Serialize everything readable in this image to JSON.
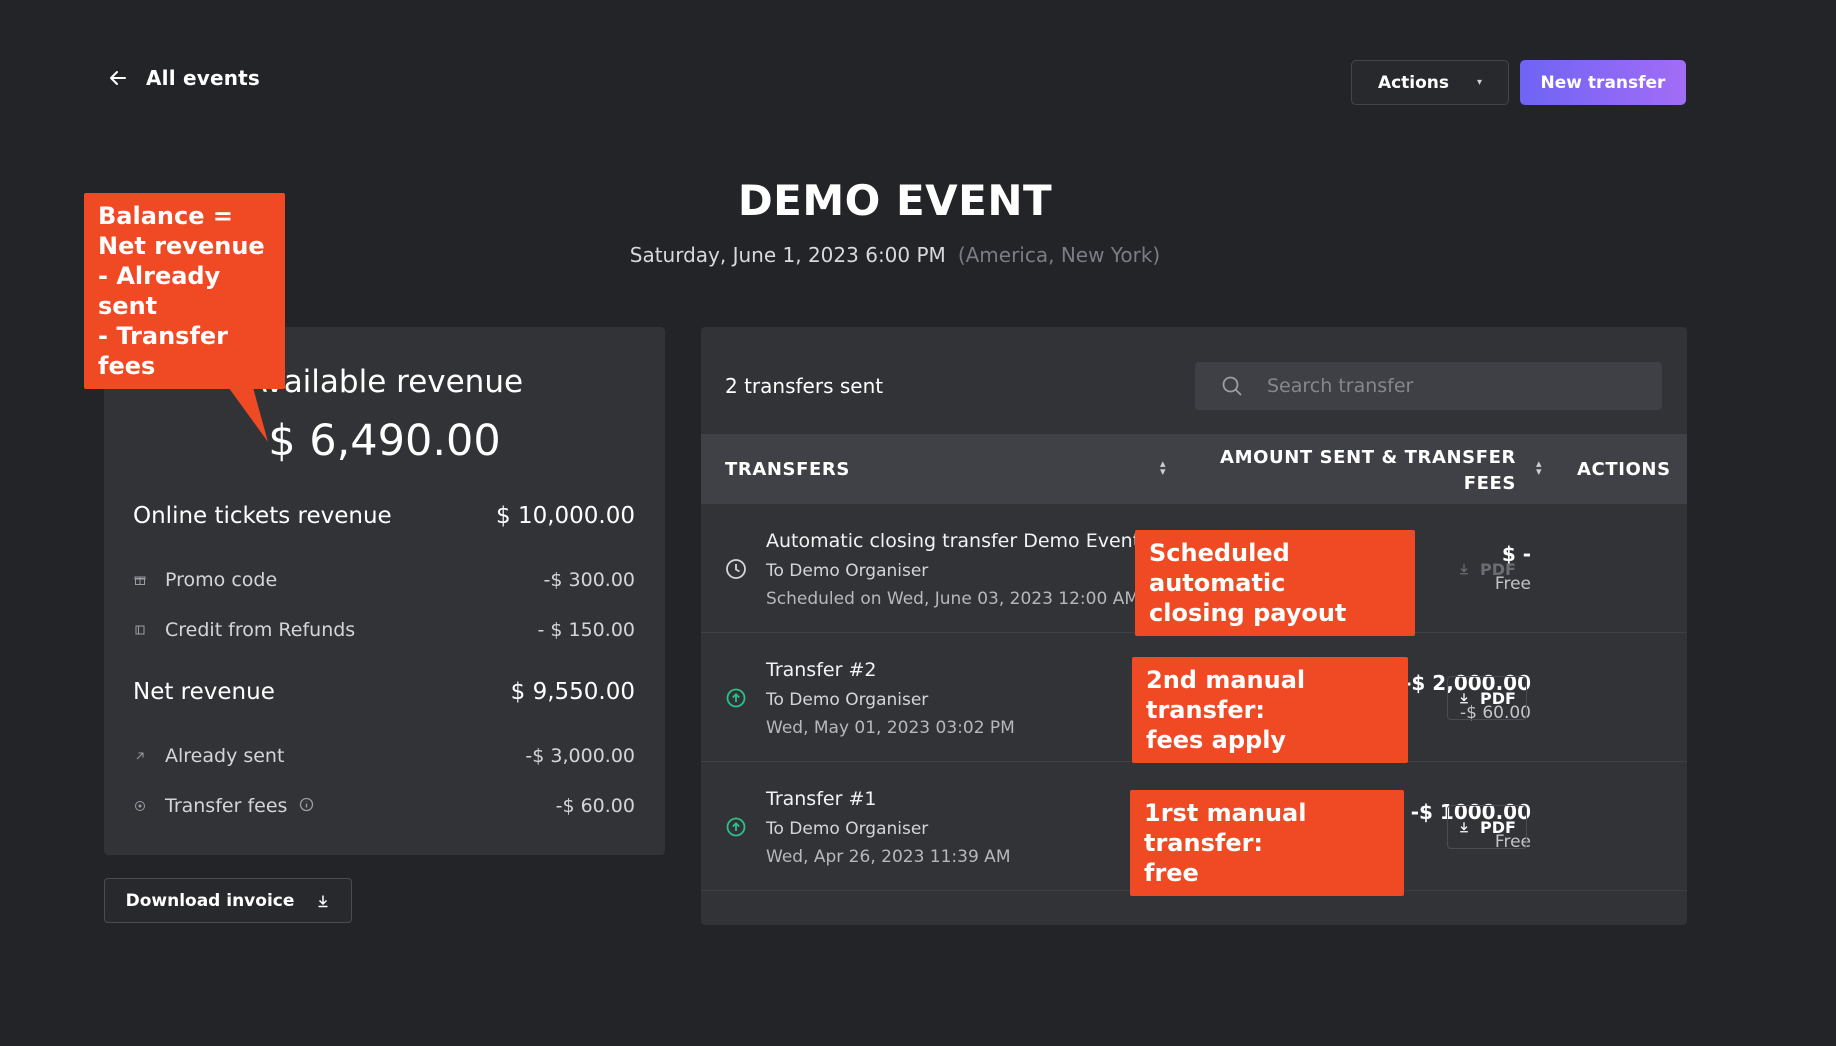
{
  "nav": {
    "back_label": "All events"
  },
  "header": {
    "actions_label": "Actions",
    "new_transfer_label": "New transfer"
  },
  "event": {
    "title": "DEMO EVENT",
    "date": "Saturday, June 1, 2023 6:00 PM",
    "timezone": "(America, New York)"
  },
  "revenue": {
    "available_label": "Available revenue",
    "available_value": "$ 6,490.00",
    "online_label": "Online tickets revenue",
    "online_value": "$ 10,000.00",
    "promo_label": "Promo code",
    "promo_value": "-$ 300.00",
    "refunds_label": "Credit from Refunds",
    "refunds_value": "- $ 150.00",
    "net_label": "Net revenue",
    "net_value": "$ 9,550.00",
    "sent_label": "Already sent",
    "sent_value": "-$ 3,000.00",
    "fees_label": "Transfer fees",
    "fees_value": "-$ 60.00",
    "download_label": "Download invoice"
  },
  "transfers": {
    "count_label": "2 transfers sent",
    "search_placeholder": "Search transfer",
    "col_transfers": "TRANSFERS",
    "col_amount_line1": "AMOUNT SENT & TRANSFER",
    "col_amount_line2": "FEES",
    "col_actions": "ACTIONS",
    "rows": [
      {
        "name": "Automatic closing transfer Demo Event",
        "to": "To Demo Organiser",
        "date": "Scheduled on Wed, June 03, 2023 12:00 AM",
        "amount": "$ -",
        "fee": "Free",
        "pdf": "PDF",
        "status": "scheduled"
      },
      {
        "name": "Transfer #2",
        "to": "To Demo Organiser",
        "date": "Wed, May 01, 2023 03:02 PM",
        "amount": "-$ 2,000.00",
        "fee": "-$ 60.00",
        "pdf": "PDF",
        "status": "sent"
      },
      {
        "name": "Transfer #1",
        "to": "To Demo Organiser",
        "date": "Wed, Apr 26, 2023 11:39 AM",
        "amount": "-$ 1000.00",
        "fee": "Free",
        "pdf": "PDF",
        "status": "sent"
      }
    ]
  },
  "annotations": {
    "balance": "Balance =\nNet revenue\n- Already sent\n- Transfer fees",
    "scheduled": "Scheduled automatic\nclosing payout",
    "second": "2nd manual transfer:\nfees apply",
    "first": "1rst manual transfer:\nfree"
  },
  "colors": {
    "background": "#232427",
    "card": "#323337",
    "accent": "#8a68f5",
    "callout": "#f04a24",
    "success": "#2fbf8a"
  }
}
